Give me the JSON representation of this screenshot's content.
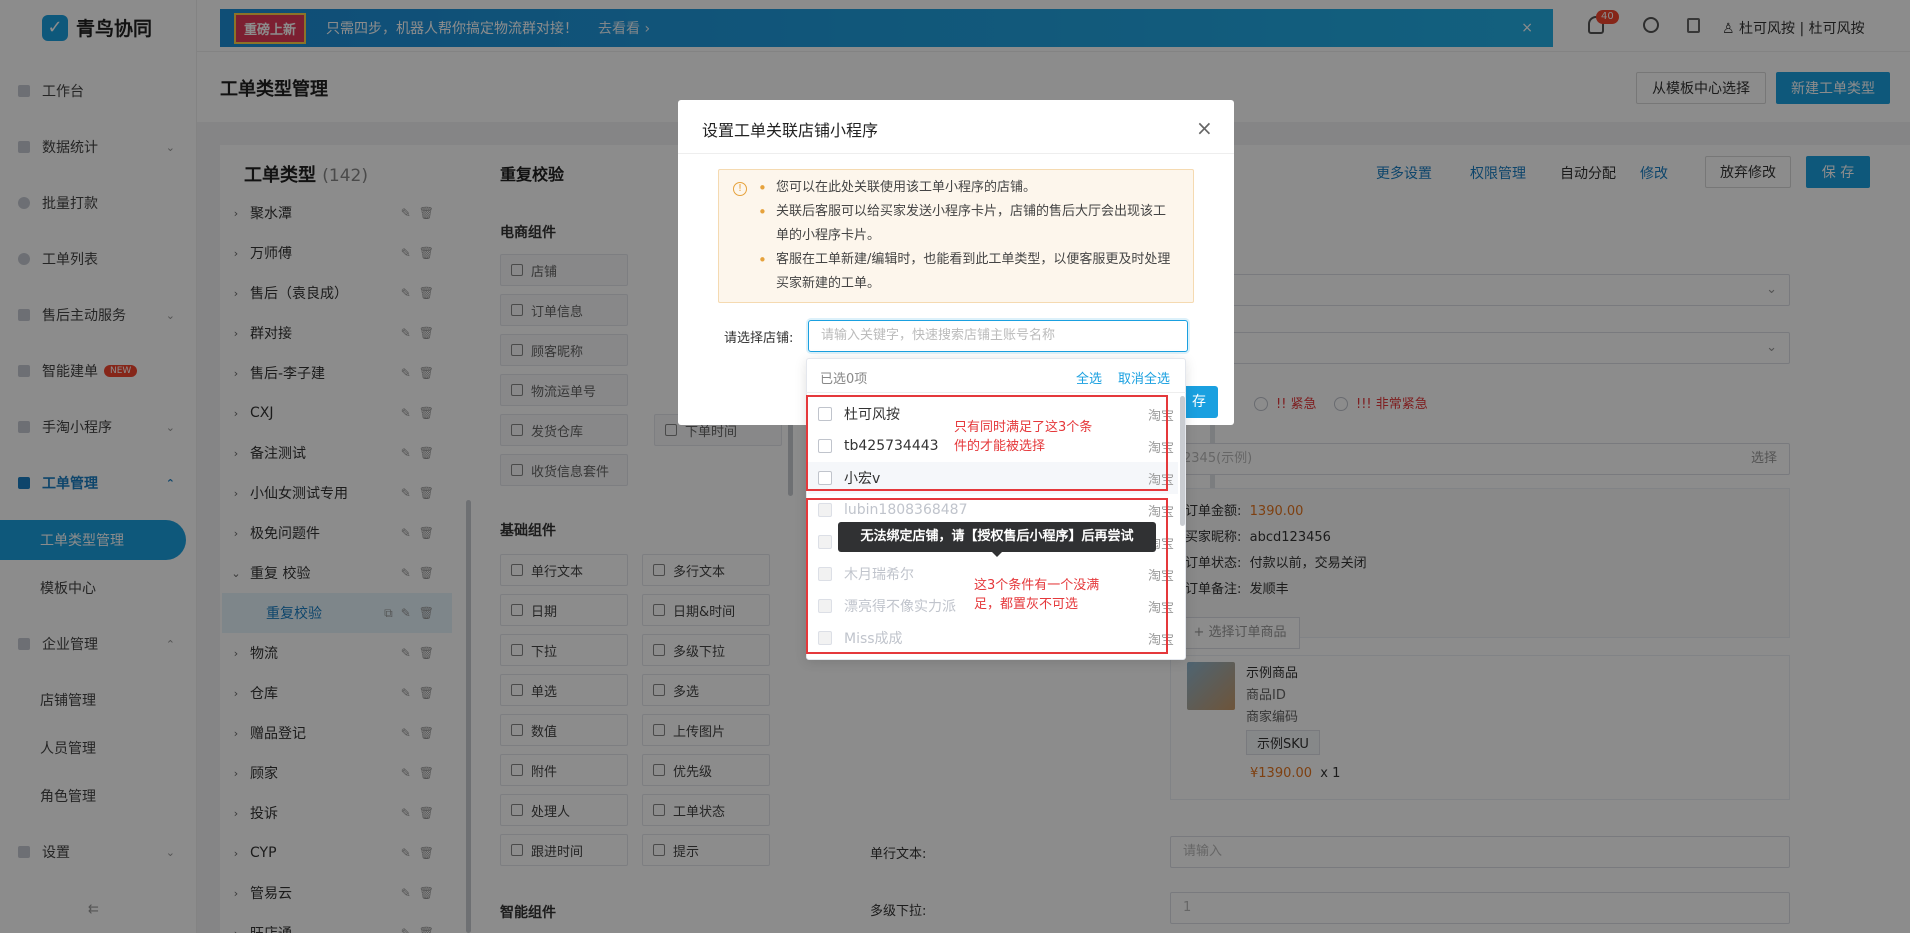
{
  "app": {
    "name": "青鸟协同"
  },
  "banner": {
    "tag": "重磅上新",
    "text": "只需四步，机器人帮你搞定物流群对接！",
    "link": "去看看 ›",
    "close": "×"
  },
  "topbar": {
    "notif_count": "40",
    "user": "杜可风按 | 杜可风按"
  },
  "sidebar": {
    "items": [
      {
        "label": "工作台"
      },
      {
        "label": "数据统计"
      },
      {
        "label": "批量打款"
      },
      {
        "label": "工单列表"
      },
      {
        "label": "售后主动服务"
      },
      {
        "label": "智能建单",
        "badge": "NEW"
      },
      {
        "label": "手淘小程序"
      },
      {
        "label": "工单管理"
      },
      {
        "label": "工单类型管理"
      },
      {
        "label": "模板中心"
      },
      {
        "label": "企业管理"
      },
      {
        "label": "店铺管理"
      },
      {
        "label": "人员管理"
      },
      {
        "label": "角色管理"
      },
      {
        "label": "设置"
      }
    ],
    "collapse": "⇇"
  },
  "page": {
    "title": "工单类型管理",
    "btn_template": "从模板中心选择",
    "btn_new": "新建工单类型"
  },
  "tree": {
    "title": "工单类型",
    "count": "(142)",
    "items": [
      {
        "label": "聚水潭"
      },
      {
        "label": "万师傅"
      },
      {
        "label": "售后（袁良成）"
      },
      {
        "label": "群对接"
      },
      {
        "label": "售后-李子建"
      },
      {
        "label": "CXJ"
      },
      {
        "label": "备注测试"
      },
      {
        "label": "小仙女测试专用"
      },
      {
        "label": "极免问题件"
      },
      {
        "label": "重复 校验"
      },
      {
        "label": "重复校验"
      },
      {
        "label": "物流"
      },
      {
        "label": "仓库"
      },
      {
        "label": "赠品登记"
      },
      {
        "label": "顾家"
      },
      {
        "label": "投诉"
      },
      {
        "label": "CYP"
      },
      {
        "label": "管易云"
      },
      {
        "label": "旺店通"
      }
    ]
  },
  "editor": {
    "title": "重复校验",
    "more": "更多设置",
    "perm": "权限管理",
    "auto": "自动分配",
    "modify": "修改",
    "discard": "放弃修改",
    "save": "保 存",
    "ecom_title": "电商组件",
    "ecom": [
      "店铺",
      "订单信息",
      "顾客昵称",
      "物流运单号",
      "发货仓库",
      "收货信息套件"
    ],
    "ecom_right": [
      "下单时间"
    ],
    "basic_title": "基础组件",
    "basic": [
      "单行文本",
      "多行文本",
      "日期",
      "日期&时间",
      "下拉",
      "多级下拉",
      "单选",
      "多选",
      "数值",
      "上传图片",
      "附件",
      "优先级",
      "处理人",
      "工单状态",
      "跟进时间",
      "提示"
    ],
    "smart_title": "智能组件"
  },
  "preview": {
    "urgent": "!! 紧急",
    "very_urgent": "!!! 非常紧急",
    "search_ph": "2345(示例)",
    "select": "选择",
    "order_amount_label": "订单金额:",
    "order_amount": "1390.00",
    "buyer_label": "买家昵称:",
    "buyer": "abcd123456",
    "status_label": "订单状态:",
    "status": "付款以前，交易关闭",
    "remark_label": "订单备注:",
    "remark": "发顺丰",
    "pick_goods": "+ 选择订单商品",
    "goods_name": "示例商品",
    "goods_id": "商品ID",
    "goods_code": "商家编码",
    "sku": "示例SKU",
    "price": "¥1390.00",
    "qty": "x 1",
    "single_label": "单行文本:",
    "single_ph": "请输入",
    "multi_label": "多级下拉:",
    "multi_val": "1"
  },
  "modal": {
    "title": "设置工单关联店铺小程序",
    "close": "×",
    "notices": [
      "您可以在此处关联使用该工单小程序的店铺。",
      "关联后客服可以给买家发送小程序卡片，店铺的售后大厅会出现该工单的小程序卡片。",
      "客服在工单新建/编辑时，也能看到此工单类型，以便客服更及时处理买家新建的工单。"
    ],
    "store_label": "请选择店铺:",
    "search_placeholder": "请输入关键字，快速搜索店铺主账号名称",
    "save_partial": "存"
  },
  "dropdown": {
    "selected_count": "已选0项",
    "select_all": "全选",
    "deselect_all": "取消全选",
    "options": [
      {
        "name": "杜可风按",
        "platform": "淘宝",
        "disabled": false
      },
      {
        "name": "tb425734443",
        "platform": "淘宝",
        "disabled": false
      },
      {
        "name": "小宏v",
        "platform": "淘宝",
        "disabled": false
      },
      {
        "name": "lubin1808368487",
        "platform": "淘宝",
        "disabled": true
      },
      {
        "name": "",
        "platform": "淘宝",
        "disabled": true
      },
      {
        "name": "木月瑞希尔",
        "platform": "淘宝",
        "disabled": true
      },
      {
        "name": "漂亮得不像实力派",
        "platform": "淘宝",
        "disabled": true
      },
      {
        "name": "Miss成成",
        "platform": "淘宝",
        "disabled": true
      }
    ],
    "tooltip": "无法绑定店铺，请【授权售后小程序】后再尝试"
  },
  "annotations": {
    "enabled_note": "只有同时满足了这3个条件的才能被选择",
    "disabled_note": "这3个条件有一个没满足，都置灰不可选",
    "color": "#e5383b"
  },
  "colors": {
    "accent": "#1aa0e0",
    "danger": "#e5383b",
    "price": "#e6761f"
  }
}
